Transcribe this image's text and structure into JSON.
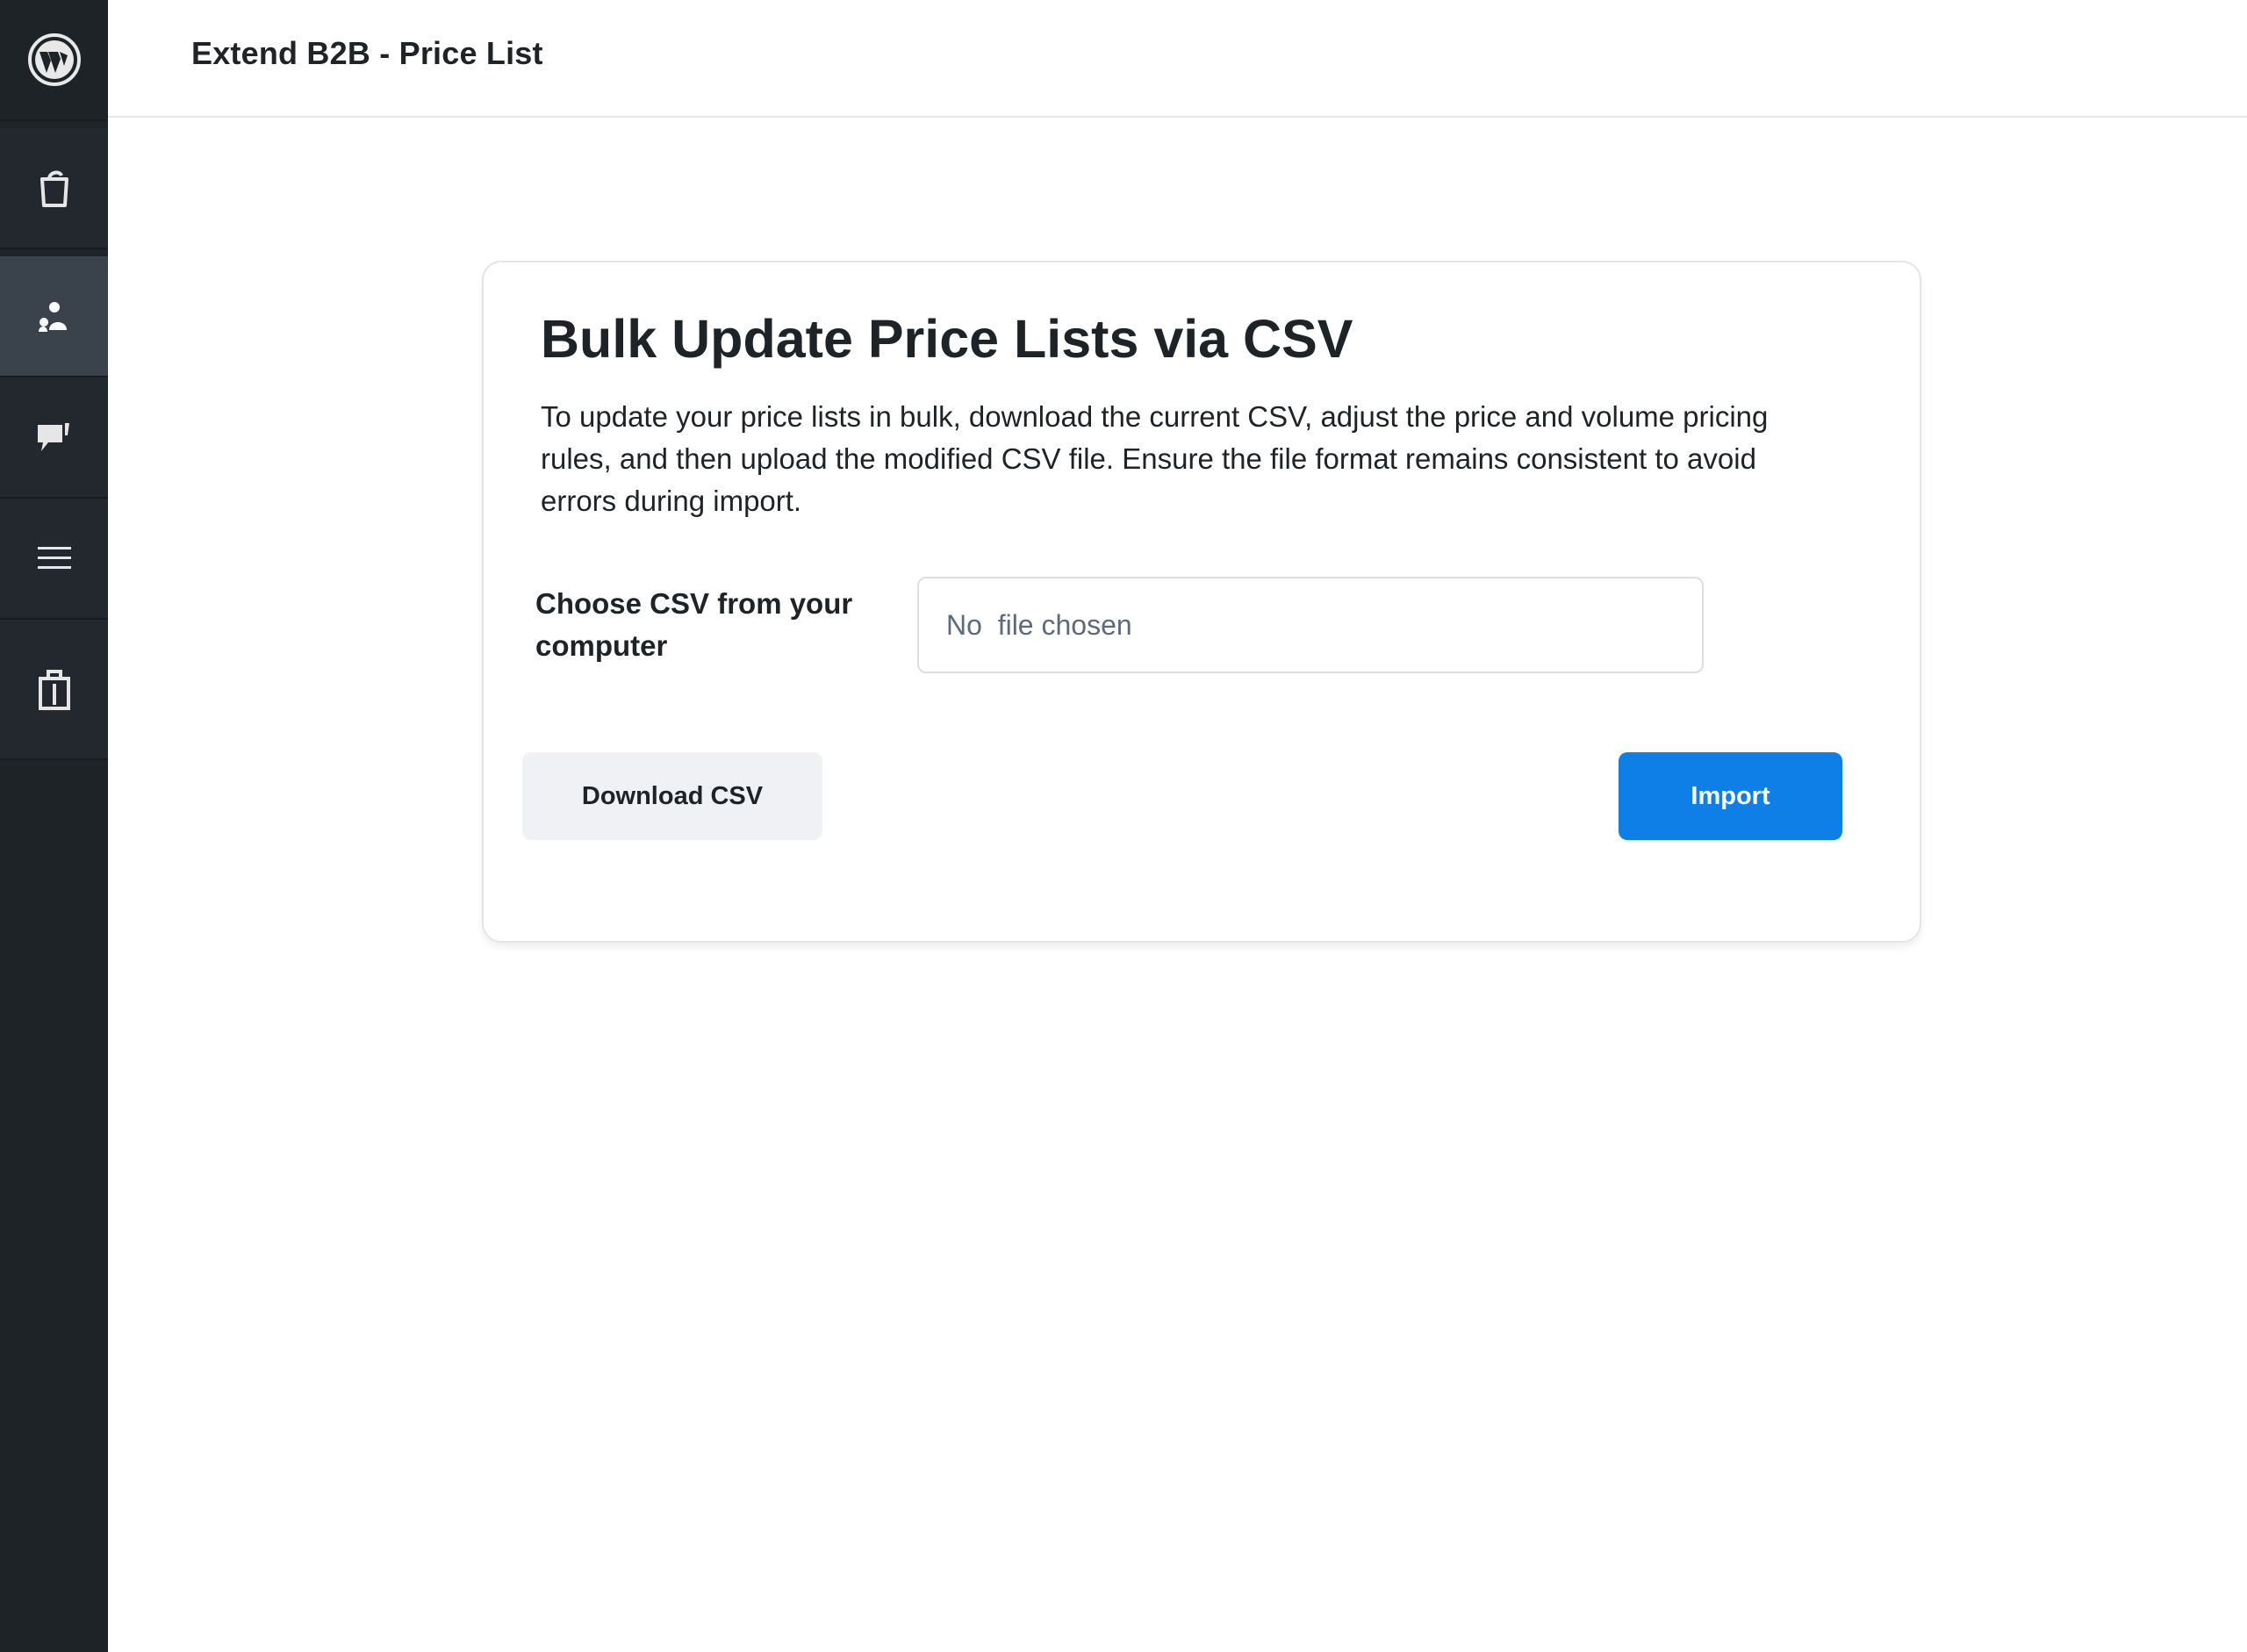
{
  "header": {
    "title": "Extend B2B - Price List"
  },
  "sidebar": {
    "items": [
      {
        "icon": "wordpress-logo-icon"
      },
      {
        "icon": "bag-icon"
      },
      {
        "icon": "users-icon",
        "active": true
      },
      {
        "icon": "speech-bubble-icon"
      },
      {
        "icon": "menu-lines-icon"
      },
      {
        "icon": "shopping-bag-icon"
      }
    ]
  },
  "card": {
    "title": "Bulk Update Price Lists via CSV",
    "description": "To update your price lists in bulk, download the current CSV, adjust the price and volume pricing rules, and then upload the modified CSV file. Ensure the file format remains consistent to avoid errors during import.",
    "file_label": "Choose CSV from your computer",
    "file_status": "No  file chosen",
    "download_label": "Download CSV",
    "import_label": "Import"
  },
  "colors": {
    "sidebar_bg": "#1d2327",
    "accent": "#0f7fe8",
    "secondary_button": "#f0f1f4"
  }
}
